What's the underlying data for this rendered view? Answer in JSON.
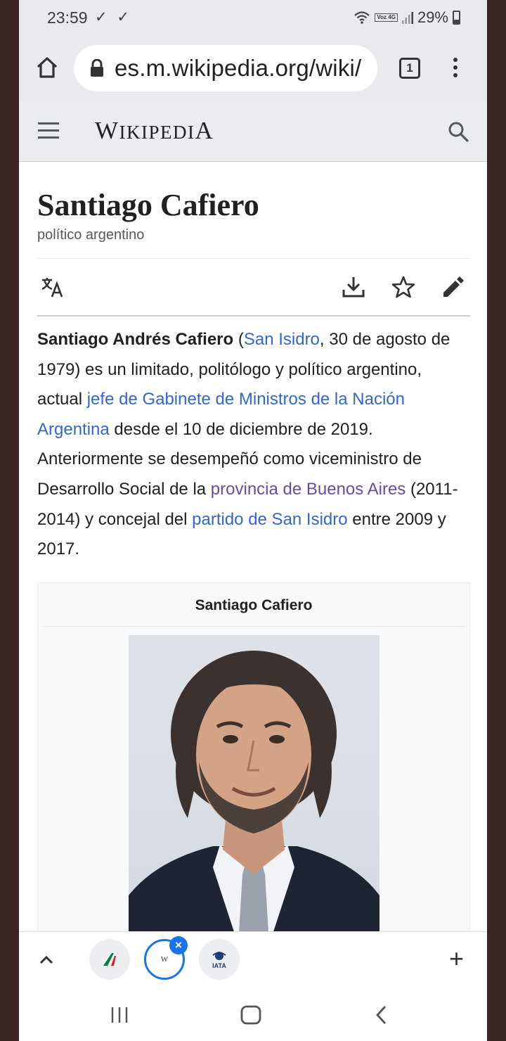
{
  "status_bar": {
    "time": "23:59",
    "checks": "✓ ✓",
    "network_badge": "Voz 4G",
    "battery_percent": "29%",
    "battery_level": 0.29
  },
  "browser": {
    "url": "es.m.wikipedia.org/wiki/",
    "tab_count": "1"
  },
  "wiki_header": {
    "logo_first": "W",
    "logo_rest": "IKIPEDI",
    "logo_last": "A"
  },
  "article": {
    "title": "Santiago Cafiero",
    "subtitle": "político argentino",
    "lead": {
      "bold_name": "Santiago Andrés Cafiero",
      "t1": " (",
      "link_san_isidro": "San Isidro",
      "t2": ", 30 de agosto de 1979) es un limitado, politólogo y político argentino, actual ",
      "link_jefe": "jefe de Gabinete de Ministros de la Nación Argentina",
      "t3": " desde el 10 de diciembre de 2019. Anteriormente se desempeñó como viceministro de Desarrollo Social de la ",
      "link_provincia": "provincia de Buenos Aires",
      "t4": " (2011-2014) y concejal del ",
      "link_partido": "partido de San Isidro",
      "t5": " entre 2009 y 2017."
    },
    "infobox": {
      "title": "Santiago Cafiero"
    }
  },
  "tab_strip": {
    "active_tab_favicon": "W",
    "close_symbol": "×",
    "new_tab_symbol": "+",
    "iata_label": "IATA"
  },
  "colors": {
    "link": "#3366cc",
    "visited_link": "#6b4ba1",
    "accent": "#1a73e8"
  }
}
